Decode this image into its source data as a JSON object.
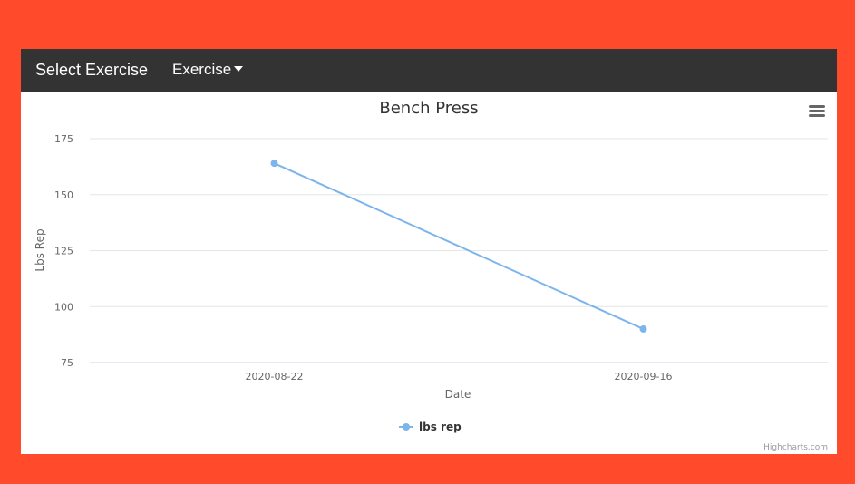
{
  "navbar": {
    "brand": "Select Exercise",
    "dropdown_label": "Exercise"
  },
  "credits": "Highcharts.com",
  "colors": {
    "background": "#ff4a2c",
    "navbar": "#333333",
    "series": "#7cb5ec"
  },
  "chart_data": {
    "type": "line",
    "title": "Bench Press",
    "xlabel": "Date",
    "ylabel": "Lbs Rep",
    "categories": [
      "2020-08-22",
      "2020-09-16"
    ],
    "series": [
      {
        "name": "lbs rep",
        "values": [
          164,
          90
        ]
      }
    ],
    "ylim": [
      75,
      175
    ],
    "yticks": [
      75,
      100,
      125,
      150,
      175
    ],
    "grid": true,
    "legend": "bottom-center"
  }
}
